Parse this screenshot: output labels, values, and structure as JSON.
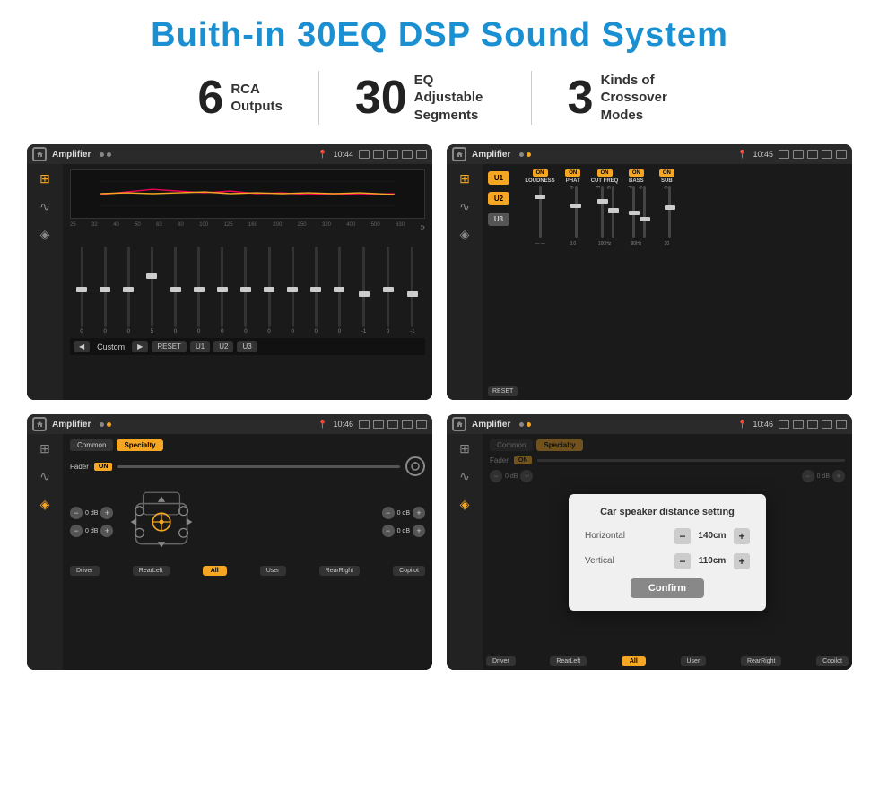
{
  "title": "Buith-in 30EQ DSP Sound System",
  "stats": [
    {
      "number": "6",
      "desc": "RCA\nOutputs"
    },
    {
      "number": "30",
      "desc": "EQ Adjustable\nSegments"
    },
    {
      "number": "3",
      "desc": "Kinds of\nCrossover Modes"
    }
  ],
  "screens": {
    "eq": {
      "status_title": "Amplifier",
      "time": "10:44",
      "eq_freqs": [
        "25",
        "32",
        "40",
        "50",
        "63",
        "80",
        "100",
        "125",
        "160",
        "200",
        "250",
        "320",
        "400",
        "500",
        "630"
      ],
      "eq_values": [
        "0",
        "0",
        "0",
        "5",
        "0",
        "0",
        "0",
        "0",
        "0",
        "0",
        "0",
        "0",
        "-1",
        "0",
        "-1"
      ],
      "controls": [
        "◀",
        "Custom",
        "▶",
        "RESET",
        "U1",
        "U2",
        "U3"
      ]
    },
    "crossover": {
      "status_title": "Amplifier",
      "time": "10:45",
      "presets": [
        "U1",
        "U2",
        "U3"
      ],
      "modules": [
        {
          "label": "LOUDNESS",
          "on": true
        },
        {
          "label": "PHAT",
          "on": true
        },
        {
          "label": "CUT FREQ",
          "on": true
        },
        {
          "label": "BASS",
          "on": true
        },
        {
          "label": "SUB",
          "on": true
        }
      ],
      "reset_label": "RESET"
    },
    "specialty": {
      "status_title": "Amplifier",
      "time": "10:46",
      "tabs": [
        "Common",
        "Specialty"
      ],
      "active_tab": "Specialty",
      "fader_label": "Fader",
      "fader_on": "ON",
      "volumes": [
        "0 dB",
        "0 dB",
        "0 dB",
        "0 dB"
      ],
      "buttons": [
        "Driver",
        "RearLeft",
        "All",
        "User",
        "RearRight",
        "Copilot"
      ]
    },
    "dialog": {
      "status_title": "Amplifier",
      "time": "10:46",
      "tabs": [
        "Common",
        "Specialty"
      ],
      "dialog_title": "Car speaker distance setting",
      "horizontal_label": "Horizontal",
      "horizontal_value": "140cm",
      "vertical_label": "Vertical",
      "vertical_value": "110cm",
      "confirm_label": "Confirm",
      "buttons": [
        "Driver",
        "RearLeft",
        "All",
        "User",
        "RearRight",
        "Copilot"
      ]
    }
  }
}
